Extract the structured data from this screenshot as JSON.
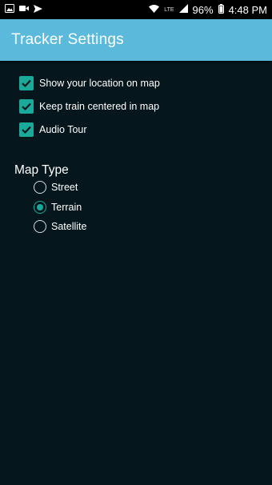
{
  "status_bar": {
    "left_icons": [
      "gallery-icon",
      "video-icon",
      "send-icon"
    ],
    "right_icons": [
      "wifi-icon",
      "lte-icon",
      "signal-icon",
      "battery-icon"
    ],
    "network_label": "LTE",
    "battery_percent": "96%",
    "time": "4:48 PM"
  },
  "app_bar": {
    "title": "Tracker Settings",
    "color": "#5bbadc"
  },
  "options": [
    {
      "label": "Show your location on map",
      "checked": true
    },
    {
      "label": "Keep train centered in map",
      "checked": true
    },
    {
      "label": "Audio Tour",
      "checked": true
    }
  ],
  "map_type": {
    "title": "Map Type",
    "selected": "Terrain",
    "options": [
      {
        "label": "Street",
        "selected": false
      },
      {
        "label": "Terrain",
        "selected": true
      },
      {
        "label": "Satellite",
        "selected": false
      }
    ]
  },
  "colors": {
    "accent": "#1ba99a",
    "background": "#06161d"
  }
}
